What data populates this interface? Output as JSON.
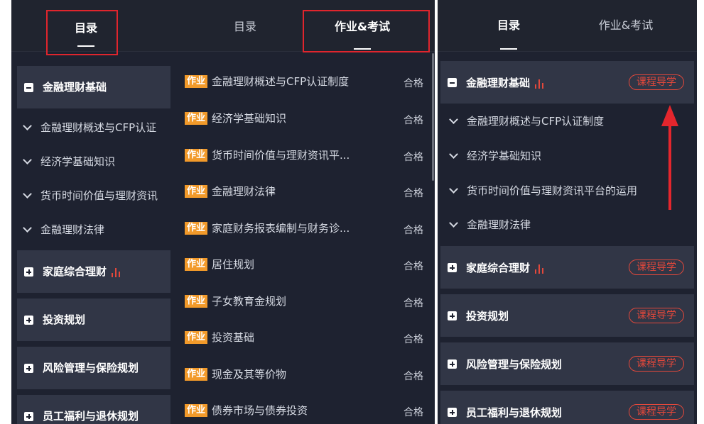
{
  "panel1": {
    "tabs": {
      "catalog": "目录"
    },
    "groups": [
      {
        "title": "金融理财基础",
        "expanded": true
      },
      {
        "title": "家庭综合理财"
      },
      {
        "title": "投资规划"
      },
      {
        "title": "风险管理与保险规划"
      },
      {
        "title": "员工福利与退休规划"
      }
    ],
    "chapters": [
      "金融理财概述与CFP认证",
      "经济学基础知识",
      "货币时间价值与理财资讯",
      "金融理财法律"
    ]
  },
  "panel2": {
    "tabs": {
      "catalog": "目录",
      "homework": "作业&考试"
    },
    "tag": "作业",
    "items": [
      {
        "title": "金融理财概述与CFP认证制度",
        "status": "合格"
      },
      {
        "title": "经济学基础知识",
        "status": "合格"
      },
      {
        "title": "货币时间价值与理财资讯平...",
        "status": "合格"
      },
      {
        "title": "金融理财法律",
        "status": "合格"
      },
      {
        "title": "家庭财务报表编制与财务诊...",
        "status": "合格"
      },
      {
        "title": "居住规划",
        "status": "合格"
      },
      {
        "title": "子女教育金规划",
        "status": "合格"
      },
      {
        "title": "投资基础",
        "status": "合格"
      },
      {
        "title": "现金及其等价物",
        "status": "合格"
      },
      {
        "title": "债券市场与债券投资",
        "status": "合格"
      }
    ]
  },
  "panel3": {
    "tabs": {
      "catalog": "目录",
      "homework": "作业&考试"
    },
    "guide_label": "课程导学",
    "groups": [
      {
        "title": "金融理财基础",
        "expanded": true
      },
      {
        "title": "家庭综合理财"
      },
      {
        "title": "投资规划"
      },
      {
        "title": "风险管理与保险规划"
      },
      {
        "title": "员工福利与退休规划"
      }
    ],
    "chapters": [
      "金融理财概述与CFP认证制度",
      "经济学基础知识",
      "货币时间价值与理财资讯平台的运用",
      "金融理财法律"
    ]
  },
  "colors": {
    "accent_red": "#e4483b",
    "tag_orange": "#f29a2a",
    "panel_bg": "#1e2230",
    "group_bg": "#313646"
  }
}
